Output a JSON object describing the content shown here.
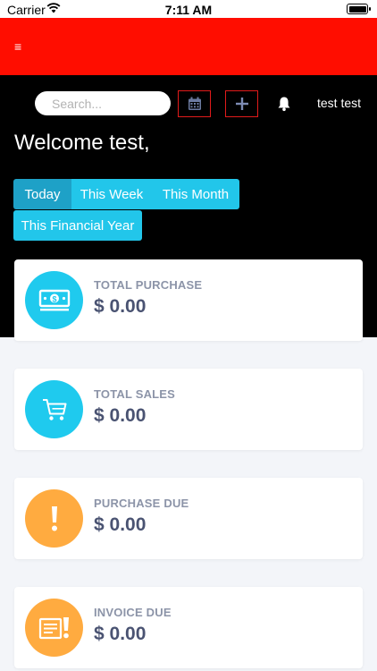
{
  "status_bar": {
    "carrier": "Carrier",
    "time": "7:11 AM"
  },
  "header": {
    "menu_icon": "≡"
  },
  "toolbar": {
    "search_placeholder": "Search...",
    "calendar_icon": "calendar-icon",
    "plus_icon": "plus-icon",
    "bell_icon": "bell-icon",
    "user_name": "test test"
  },
  "welcome": "Welcome test,",
  "periods": [
    "Today",
    "This Week",
    "This Month",
    "This Financial Year"
  ],
  "selected_period": "Today",
  "cards": [
    {
      "label": "TOTAL PURCHASE",
      "value": "$ 0.00",
      "icon": "money-icon",
      "color": "#1fcaee"
    },
    {
      "label": "TOTAL SALES",
      "value": "$ 0.00",
      "icon": "cart-icon",
      "color": "#1fcaee"
    },
    {
      "label": "PURCHASE DUE",
      "value": "$ 0.00",
      "icon": "exclamation-icon",
      "color": "#ffab40"
    },
    {
      "label": "INVOICE DUE",
      "value": "$ 0.00",
      "icon": "invoice-alert-icon",
      "color": "#ffab40"
    }
  ],
  "colors": {
    "topbar": "#ff0d00",
    "accent": "#22c6ea",
    "active_tab": "#1ea1c7",
    "icon_border": "#e21b1b"
  }
}
